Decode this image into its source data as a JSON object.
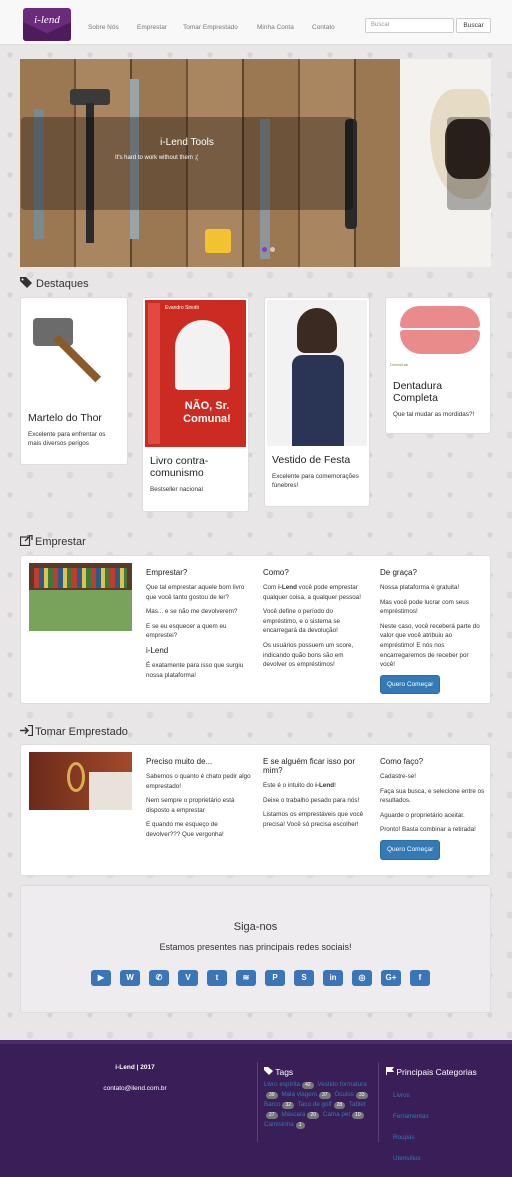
{
  "brand": {
    "logo_text": "i-lend"
  },
  "nav": {
    "items": [
      "Sobre Nós",
      "Emprestar",
      "Tomar Emprestado",
      "Minha Conta",
      "Contato"
    ]
  },
  "search": {
    "placeholder": "Buscar",
    "button": "Buscar"
  },
  "carousel": {
    "caption_title": "i-Lend Tools",
    "caption_text": "It's hard to work without them ;(",
    "active_index": 0,
    "slide_count": 2
  },
  "destaques": {
    "title": "Destaques",
    "items": [
      {
        "title": "Martelo do Thor",
        "desc": "Excelente para enfrentar os mais diversos perigos"
      },
      {
        "title": "Livro contra-comunismo",
        "desc": "Bestseller nacional",
        "cover_top": "Evandro Sinotti",
        "cover_big": "NÃO, Sr. Comuna!"
      },
      {
        "title": "Vestido de Festa",
        "desc": "Excelente para comemorações fúnebres!"
      },
      {
        "title": "Dentadura Completa",
        "desc": "Que tal mudar as mordidas?!",
        "img_label": "DentalLab"
      }
    ]
  },
  "emprestar": {
    "title": "Emprestar",
    "col1": {
      "h": "Emprestar?",
      "p1": "Que tal emprestar aquele bom livro que você tanto gostou de ler?",
      "p2": "Mas... e se não me devolverem?",
      "p3": "E se eu esquecer a quem eu emprestei?",
      "h2": "i-Lend",
      "p4": "É exatamente para isso que surgiu nossa plataforma!"
    },
    "col2": {
      "h": "Como?",
      "p1_pre": "Com ",
      "p1_bold": "i-Lend",
      "p1_post": " você pode emprestar qualquer coisa, a qualquer pessoa!",
      "p2": "Você define o período do empréstimo, e o sistema se encarregará da devolução!",
      "p3": "Os usuários possuem um score, indicando quão bons são em devolver os empréstimos!"
    },
    "col3": {
      "h": "De graça?",
      "p1": "Nossa plataforma é gratuita!",
      "p2": "Mas você pode lucrar com seus empréstimos!",
      "p3": "Neste caso, você receberá parte do valor que você atribuiu ao empréstimo! E nós nos encarregaremos de receber por você!",
      "button": "Quero Começar"
    }
  },
  "tomar": {
    "title": "Tomar Emprestado",
    "col1": {
      "h": "Preciso muito de...",
      "p1": "Sabemos o quanto é chato pedir algo emprestado!",
      "p2": "Nem sempre o proprietário está disposto a emprestar",
      "p3": "E quando me esqueço de devolver??? Que vergonha!"
    },
    "col2": {
      "h": "E se alguém ficar isso por mim?",
      "p1_pre": "Este é o intuito do ",
      "p1_bold": "i-Lend",
      "p1_post": "!",
      "p2": "Deixe o trabalho pesado para nós!",
      "p3": "Listamos os emprestáveis que você precisa! Você só precisa escolher!"
    },
    "col3": {
      "h": "Como faço?",
      "p1": "Cadastre-se!",
      "p2": "Faça sua busca, e selecione entre os resultados.",
      "p3": "Aguarde o proprietário aceitar.",
      "p4": "Pronto! Basta combinar a retirada!",
      "button": "Quero Começar"
    }
  },
  "follow": {
    "title": "Siga-nos",
    "subtitle": "Estamos presentes nas principais redes sociais!",
    "networks": [
      {
        "name": "youtube-icon",
        "glyph": "▶"
      },
      {
        "name": "wordpress-icon",
        "glyph": "W"
      },
      {
        "name": "whatsapp-icon",
        "glyph": "✆"
      },
      {
        "name": "vimeo-icon",
        "glyph": "V"
      },
      {
        "name": "twitter-icon",
        "glyph": "t"
      },
      {
        "name": "spotify-icon",
        "glyph": "≋"
      },
      {
        "name": "pinterest-icon",
        "glyph": "P"
      },
      {
        "name": "skype-icon",
        "glyph": "S"
      },
      {
        "name": "linkedin-icon",
        "glyph": "in"
      },
      {
        "name": "instagram-icon",
        "glyph": "◎"
      },
      {
        "name": "google-plus-icon",
        "glyph": "G+"
      },
      {
        "name": "facebook-icon",
        "glyph": "f"
      }
    ],
    "icon_color": "#3a75b8"
  },
  "footer": {
    "copyright": "i-Lend | 2017",
    "email": "contato@ilend.com.br",
    "tags_title": "Tags",
    "categories_title": "Principais Categorias",
    "tags": [
      {
        "label": "Livro espírita",
        "count": "42"
      },
      {
        "label": "Vestido formatura",
        "count": "39"
      },
      {
        "label": "Mala viagem",
        "count": "37"
      },
      {
        "label": "Óculos",
        "count": "33"
      },
      {
        "label": "Barco",
        "count": "32"
      },
      {
        "label": "Taco de golf",
        "count": "28"
      },
      {
        "label": "Tablet",
        "count": "27"
      },
      {
        "label": "Máscara",
        "count": "20"
      },
      {
        "label": "Cama pet",
        "count": "10"
      },
      {
        "label": "Camisinha",
        "count": "1"
      }
    ],
    "categories": [
      "Livros",
      "Ferramentas",
      "Roupas",
      "Utensílios"
    ],
    "bg_color": "#3a1e57"
  }
}
